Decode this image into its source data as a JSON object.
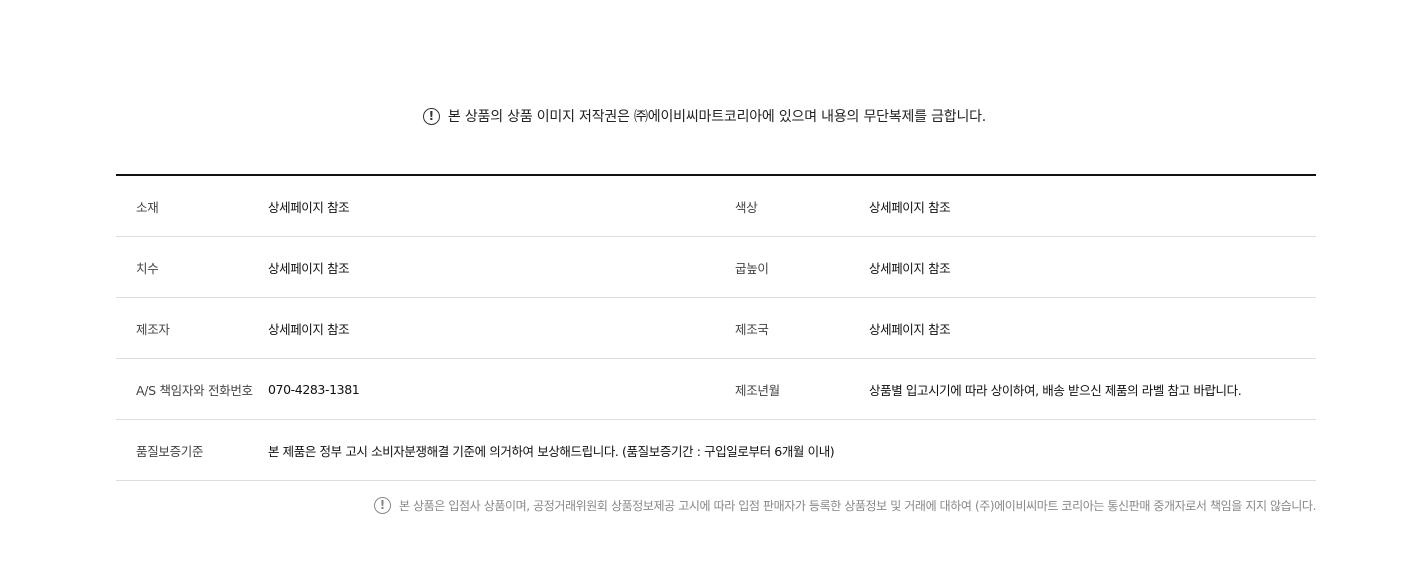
{
  "top_notice": {
    "icon": "exclamation-circle-icon",
    "icon_glyph": "!",
    "text": "본 상품의 상품 이미지 저작권은 ㈜에이비씨마트코리아에 있으며 내용의 무단복제를 금합니다."
  },
  "info": {
    "rows": [
      {
        "label1": "소재",
        "value1": "상세페이지 참조",
        "label2": "색상",
        "value2": "상세페이지 참조"
      },
      {
        "label1": "치수",
        "value1": "상세페이지 참조",
        "label2": "굽높이",
        "value2": "상세페이지 참조"
      },
      {
        "label1": "제조자",
        "value1": "상세페이지 참조",
        "label2": "제조국",
        "value2": "상세페이지 참조"
      },
      {
        "label1": "A/S 책임자와 전화번호",
        "value1": "070-4283-1381",
        "label2": "제조년월",
        "value2": "상품별 입고시기에 따라 상이하여, 배송 받으신 제품의 라벨 참고 바랍니다."
      }
    ],
    "quality": {
      "label": "품질보증기준",
      "value": "본 제품은 정부 고시 소비자분쟁해결 기준에 의거하여 보상해드립니다. (품질보증기간 : 구입일로부터 6개월 이내)"
    }
  },
  "bottom_notice": {
    "icon": "exclamation-circle-icon",
    "icon_glyph": "!",
    "text": "본 상품은 입점사 상품이며, 공정거래위원회 상품정보제공 고시에 따라 입점 판매자가 등록한 상품정보 및 거래에 대하여 (주)에이비씨마트 코리아는 통신판매 중개자로서 책임을 지지 않습니다."
  }
}
